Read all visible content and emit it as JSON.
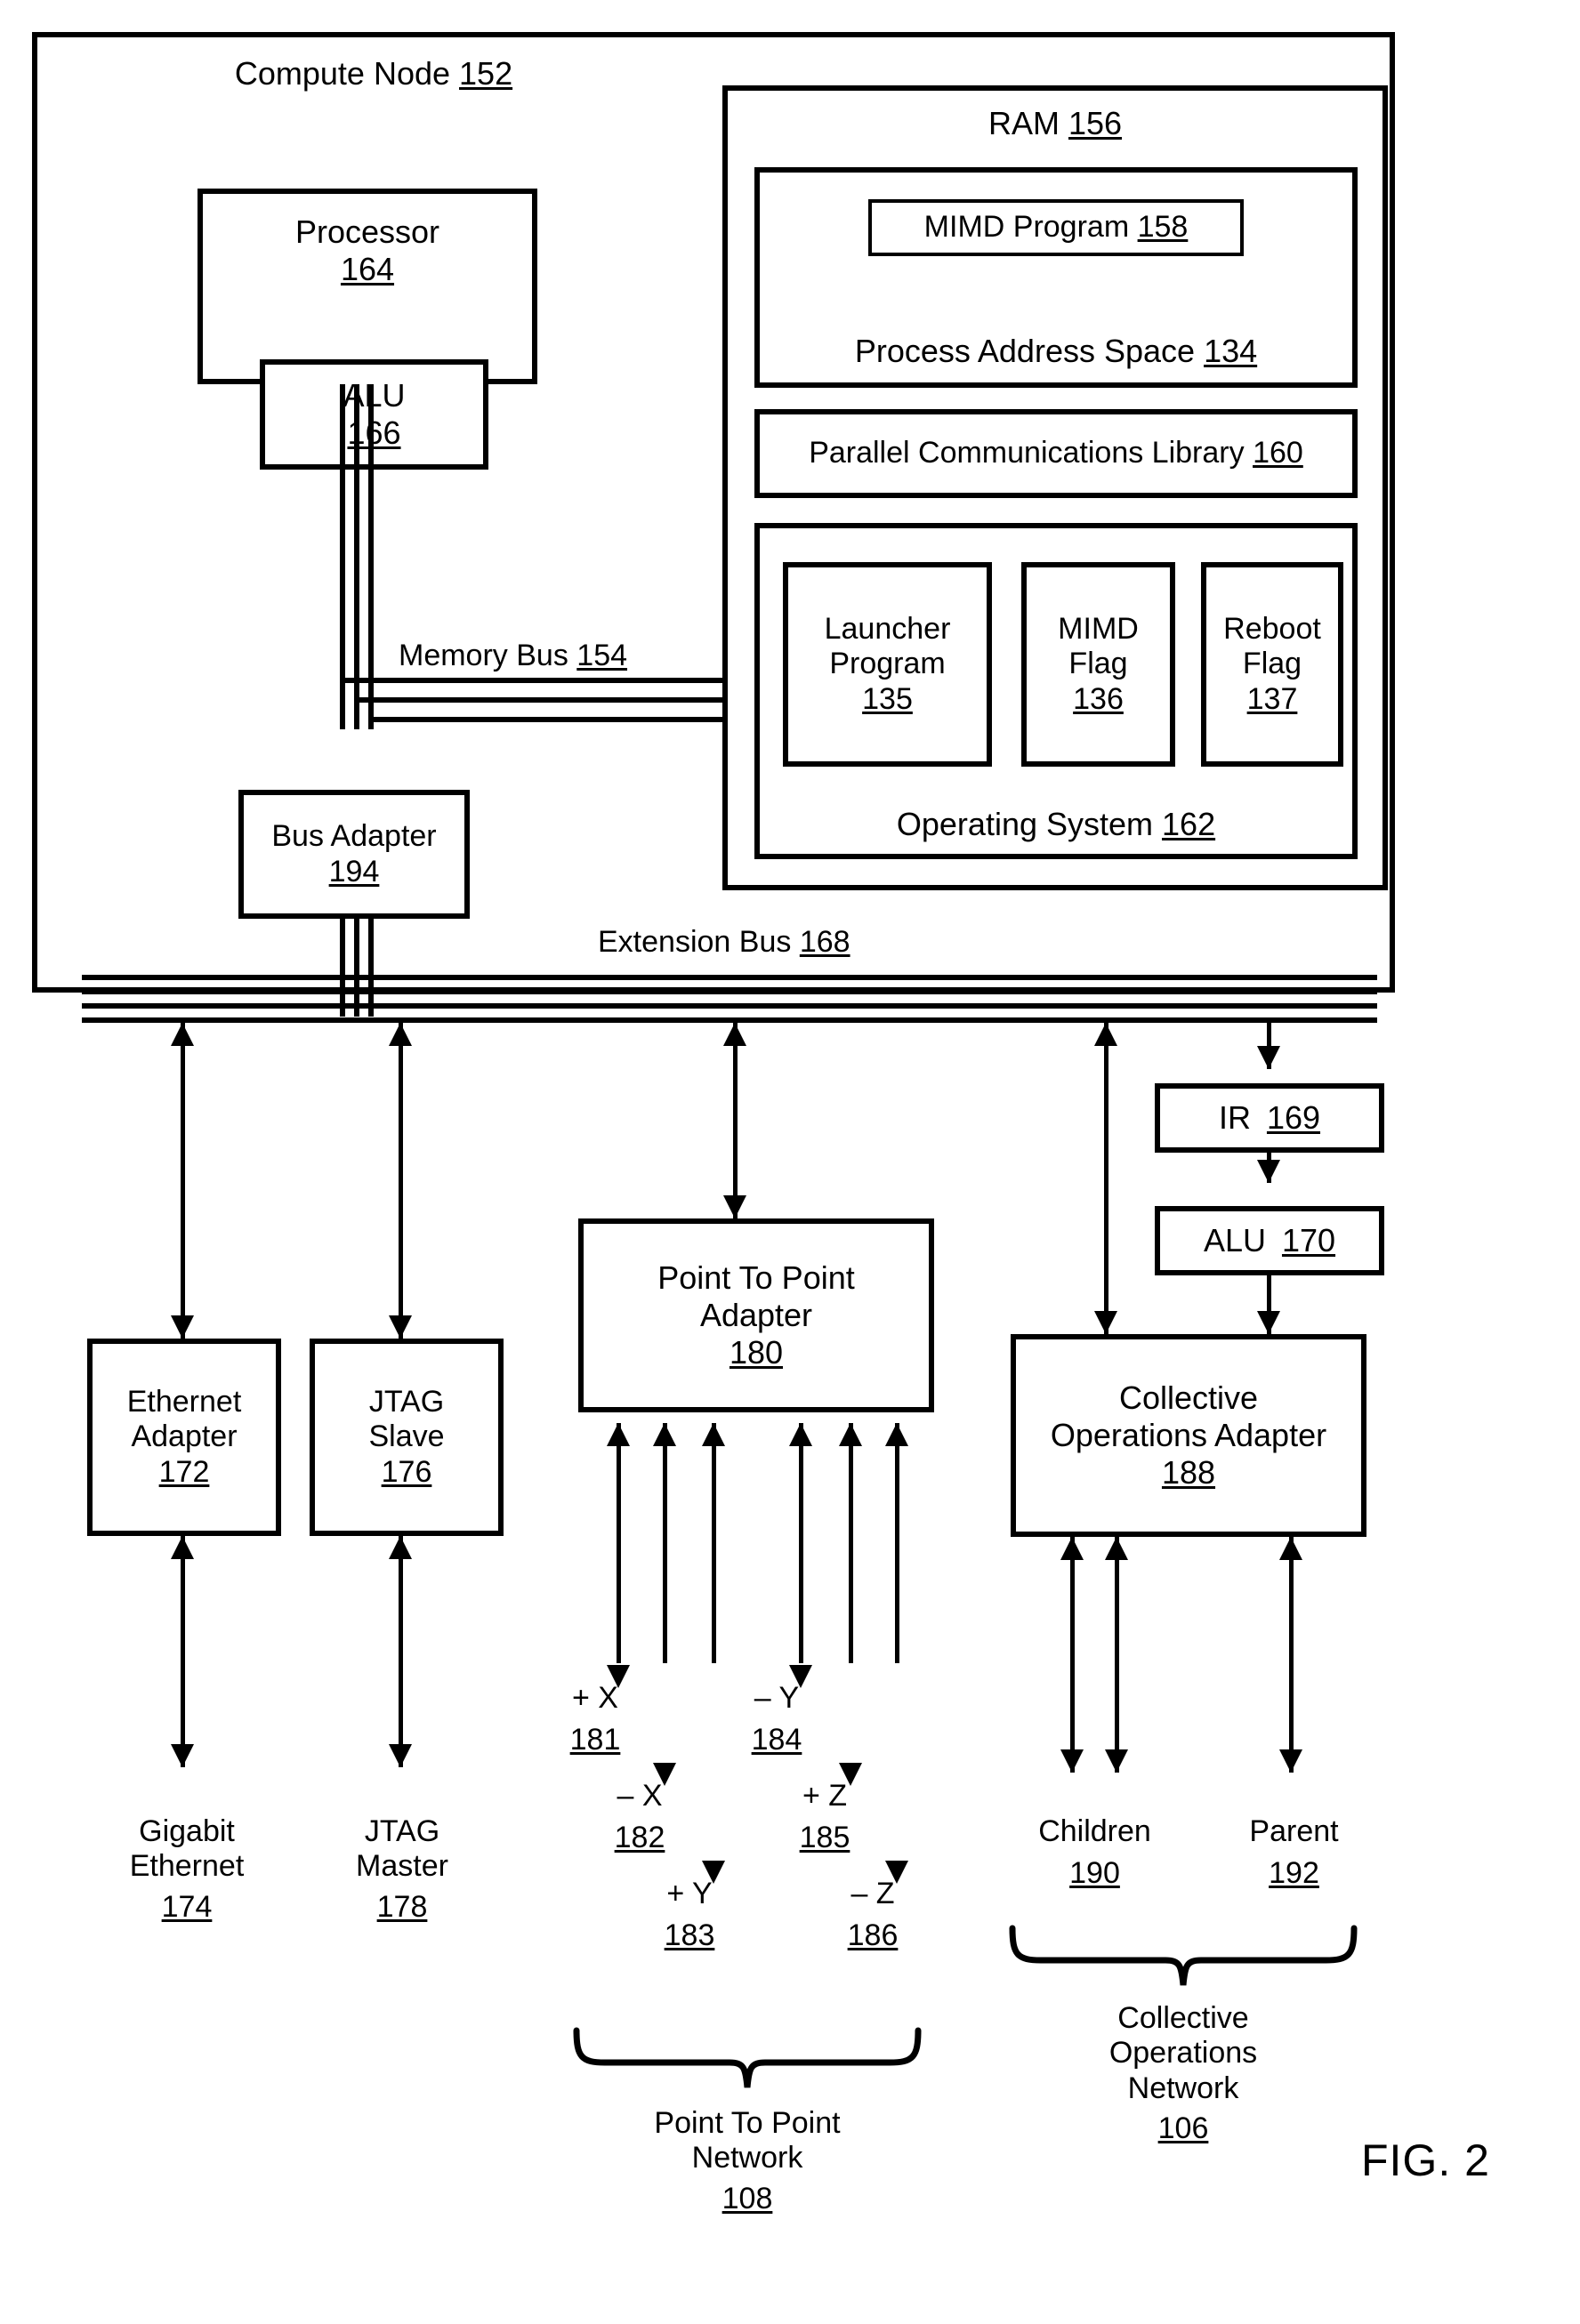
{
  "figure": {
    "caption": "FIG. 2"
  },
  "outer": {
    "label": "Compute Node",
    "ref": "152"
  },
  "processor": {
    "label": "Processor",
    "ref": "164",
    "alu": {
      "label": "ALU",
      "ref": "166"
    }
  },
  "ram": {
    "label": "RAM",
    "ref": "156",
    "process_address_space": {
      "label": "Process Address Space",
      "ref": "134",
      "mimd_program": {
        "label": "MIMD Program",
        "ref": "158"
      }
    },
    "parallel_communications_library": {
      "label": "Parallel Communications Library",
      "ref": "160"
    },
    "operating_system": {
      "label": "Operating System",
      "ref": "162",
      "items": [
        {
          "line1": "Launcher",
          "line2": "Program",
          "ref": "135"
        },
        {
          "line1": "MIMD",
          "line2": "Flag",
          "ref": "136"
        },
        {
          "line1": "Reboot",
          "line2": "Flag",
          "ref": "137"
        }
      ]
    }
  },
  "memory_bus": {
    "label": "Memory Bus",
    "ref": "154"
  },
  "bus_adapter": {
    "label": "Bus Adapter",
    "ref": "194"
  },
  "extension_bus": {
    "label": "Extension Bus",
    "ref": "168"
  },
  "ir": {
    "label": "IR",
    "ref": "169"
  },
  "alu170": {
    "label": "ALU",
    "ref": "170"
  },
  "adapters": {
    "ethernet": {
      "line1": "Ethernet",
      "line2": "Adapter",
      "ref": "172"
    },
    "jtag_slave": {
      "line1": "JTAG",
      "line2": "Slave",
      "ref": "176"
    },
    "point_to_point": {
      "line1": "Point To Point",
      "line2": "Adapter",
      "ref": "180"
    },
    "collective_ops": {
      "line1": "Collective",
      "line2": "Operations Adapter",
      "ref": "188"
    }
  },
  "endpoints": {
    "gigabit_ethernet": {
      "line1": "Gigabit",
      "line2": "Ethernet",
      "ref": "174"
    },
    "jtag_master": {
      "line1": "JTAG",
      "line2": "Master",
      "ref": "178"
    },
    "children": {
      "label": "Children",
      "ref": "190"
    },
    "parent": {
      "label": "Parent",
      "ref": "192"
    }
  },
  "torus_links": [
    {
      "label": "+ X",
      "ref": "181"
    },
    {
      "label": "– X",
      "ref": "182"
    },
    {
      "label": "+ Y",
      "ref": "183"
    },
    {
      "label": "– Y",
      "ref": "184"
    },
    {
      "label": "+ Z",
      "ref": "185"
    },
    {
      "label": "– Z",
      "ref": "186"
    }
  ],
  "networks": {
    "point_to_point": {
      "line1": "Point To Point",
      "line2": "Network",
      "ref": "108"
    },
    "collective_operations": {
      "line1": "Collective",
      "line2": "Operations",
      "line3": "Network",
      "ref": "106"
    }
  },
  "colors": {
    "ink": "#000000",
    "paper": "#ffffff"
  }
}
